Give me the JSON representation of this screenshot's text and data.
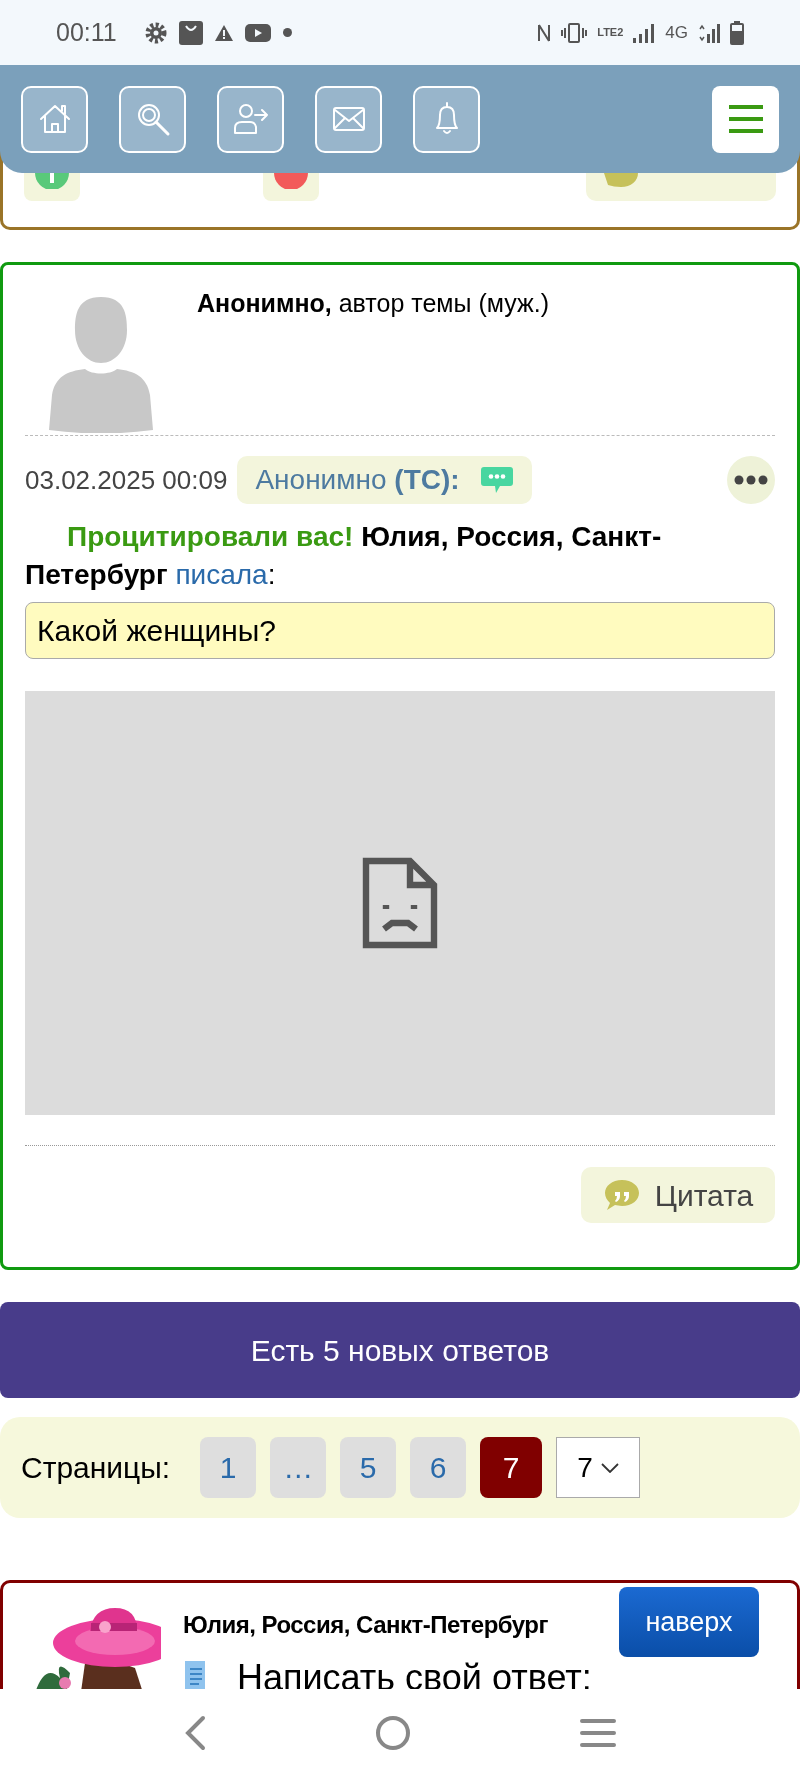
{
  "status_bar": {
    "time": "00:11",
    "volte": "LTE2",
    "network": "4G"
  },
  "toolbar": {
    "buttons": [
      {
        "kind": "home"
      },
      {
        "kind": "search"
      },
      {
        "kind": "logout"
      },
      {
        "kind": "mail"
      },
      {
        "kind": "bell"
      }
    ]
  },
  "post": {
    "author": "Анонимно,",
    "author_note": "автор темы (муж.)",
    "date": "03.02.2025 00:09",
    "recipient": "Анонимно",
    "recipient_tag": "(ТС):",
    "quote_notice": "Процитировали вас!",
    "quote_author": "Юлия, Россия, Санкт-Петербург",
    "quote_verb": "писала",
    "quote_suffix": ":",
    "quote_text": "Какой женщины?",
    "quote_button": "Цитата"
  },
  "new_replies_banner": "Есть 5 новых ответов",
  "pagination": {
    "label": "Страницы:",
    "pages": [
      {
        "label": "1",
        "selected": false
      },
      {
        "label": "…",
        "selected": false
      },
      {
        "label": "5",
        "selected": false
      },
      {
        "label": "6",
        "selected": false
      },
      {
        "label": "7",
        "selected": true
      }
    ],
    "select_value": "7"
  },
  "reply_card": {
    "author": "Юлия, Россия, Санкт-Петербург",
    "to_top": "наверх",
    "title": "Написать свой ответ:"
  }
}
